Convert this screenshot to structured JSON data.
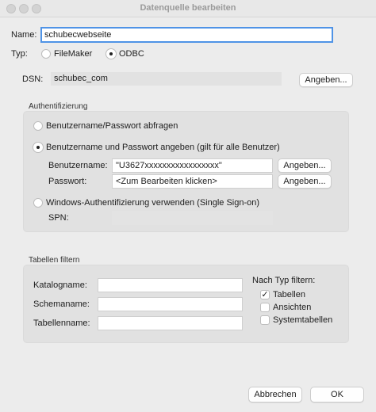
{
  "window": {
    "title": "Datenquelle bearbeiten"
  },
  "name": {
    "label": "Name:",
    "value": "schubecwebseite"
  },
  "typ": {
    "label": "Typ:",
    "options": [
      "FileMaker",
      "ODBC"
    ],
    "selected": "ODBC"
  },
  "dsn": {
    "label": "DSN:",
    "value": "schubec_com",
    "button": "Angeben..."
  },
  "auth": {
    "title": "Authentifizierung",
    "option_prompt": "Benutzername/Passwort abfragen",
    "option_specify": "Benutzername und Passwort angeben (gilt für alle Benutzer)",
    "username_label": "Benutzername:",
    "username_value": "\"U3627xxxxxxxxxxxxxxxxx\"",
    "password_label": "Passwort:",
    "password_value": "<Zum Bearbeiten klicken>",
    "specify_button": "Angeben...",
    "option_windows": "Windows-Authentifizierung verwenden (Single Sign-on)",
    "spn_label": "SPN:",
    "spn_value": "",
    "selected": "specify"
  },
  "filter": {
    "title": "Tabellen filtern",
    "catalog_label": "Katalogname:",
    "schema_label": "Schemaname:",
    "table_label": "Tabellenname:",
    "catalog_value": "",
    "schema_value": "",
    "table_value": "",
    "type_label": "Nach Typ filtern:",
    "types": [
      {
        "label": "Tabellen",
        "checked": true
      },
      {
        "label": "Ansichten",
        "checked": false
      },
      {
        "label": "Systemtabellen",
        "checked": false
      }
    ]
  },
  "buttons": {
    "cancel": "Abbrechen",
    "ok": "OK"
  },
  "colors": {
    "focus_ring": "#4f93e6",
    "window_bg": "#ececec",
    "group_bg": "#e1e1e1"
  }
}
